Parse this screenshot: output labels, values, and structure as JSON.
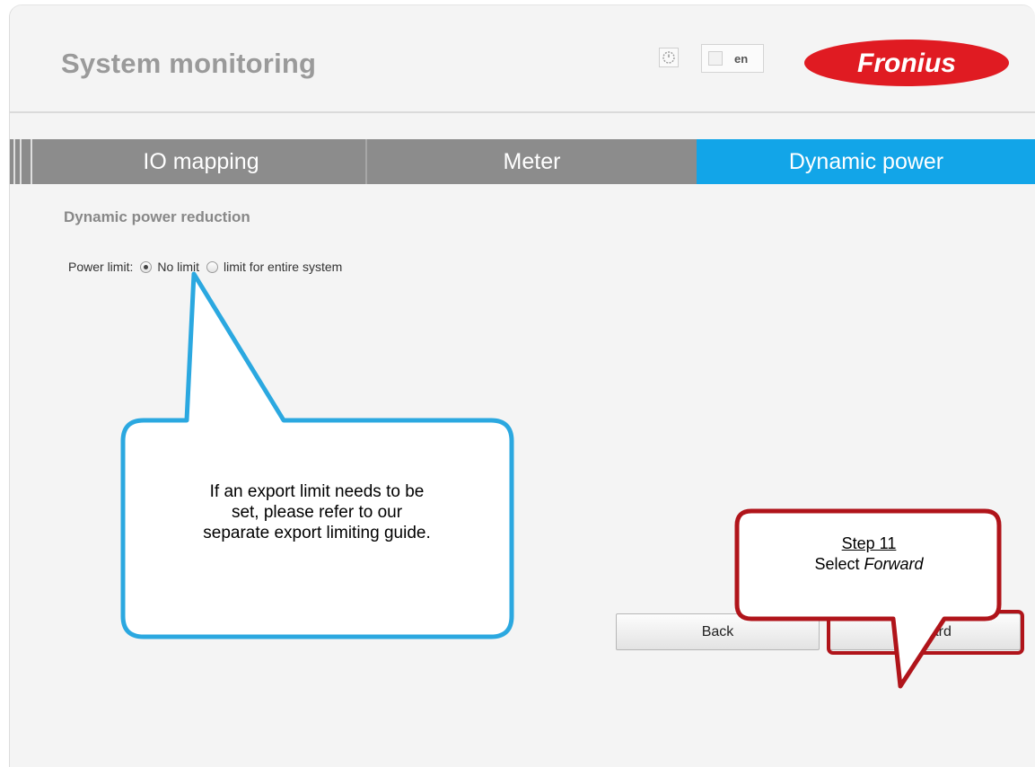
{
  "header": {
    "title": "System monitoring",
    "language": "en",
    "logo_text": "Fronius",
    "icons": {
      "timer": "clock-icon",
      "language": "flag-icon"
    }
  },
  "tabs": [
    {
      "label": "IO mapping",
      "active": false
    },
    {
      "label": "Meter",
      "active": false
    },
    {
      "label": "Dynamic power",
      "active": true
    }
  ],
  "section": {
    "title": "Dynamic power reduction"
  },
  "power_limit": {
    "label": "Power limit:",
    "options": [
      {
        "label": "No limit",
        "selected": true
      },
      {
        "label": "limit for entire system",
        "selected": false
      }
    ]
  },
  "buttons": {
    "back": "Back",
    "forward": "Forward"
  },
  "callouts": {
    "info": {
      "line1": "If an export limit needs to be",
      "line2": "set, please refer to our",
      "line3": "separate export limiting guide."
    },
    "step": {
      "label": "Step 11",
      "action": "Select",
      "target": "Forward"
    }
  },
  "colors": {
    "active_tab": "#12a5e8",
    "inactive_tab": "#8c8c8c",
    "brand_red": "#e01b22",
    "callout_blue": "#2ba8e0",
    "callout_red": "#b0141a"
  }
}
